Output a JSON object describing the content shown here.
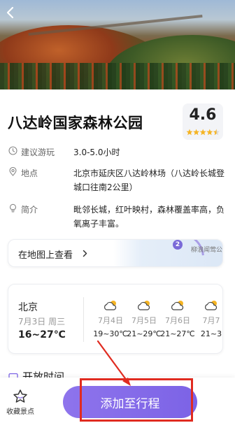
{
  "attraction": {
    "name": "八达岭国家森林公园",
    "rating": "4.6",
    "rating_stars": 4.5
  },
  "info": [
    {
      "icon": "clock-icon",
      "label": "建议游玩",
      "value": "3.0-5.0小时"
    },
    {
      "icon": "location-pin-icon",
      "label": "地点",
      "value": "北京市延庆区八达岭林场（八达岭长城登城口往南2公里）"
    },
    {
      "icon": "bulb-icon",
      "label": "简介",
      "value": "毗邻长城，红叶映村，森林覆盖率高，负氧离子丰富。"
    }
  ],
  "map_link": {
    "label": "在地图上查看",
    "pin_number": "2",
    "place": "柳浪闻莺公园"
  },
  "weather": {
    "city": "北京",
    "date": "7月3日 周三",
    "temp": "16~27℃",
    "forecast": [
      {
        "date": "7月4日",
        "temp": "19~30℃"
      },
      {
        "date": "7月5日",
        "temp": "21~29℃"
      },
      {
        "date": "7月6日",
        "temp": "21~27℃"
      },
      {
        "date": "7月7",
        "temp": "21~3"
      }
    ]
  },
  "section_peek": {
    "label": "开放时间"
  },
  "bottom_bar": {
    "favorite_label": "收藏景点",
    "add_button_label": "添加至行程"
  },
  "colors": {
    "accent_purple": "#8e74ec",
    "star_gold": "#f5b423",
    "annotation_red": "#e02b20"
  }
}
